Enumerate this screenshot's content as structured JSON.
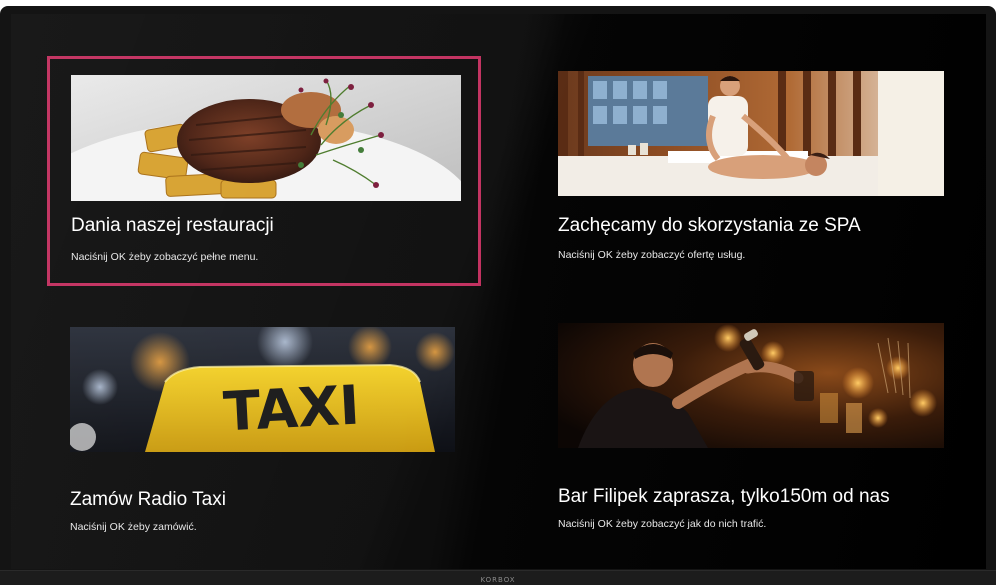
{
  "brand": "KORBOX",
  "tiles": [
    {
      "title": "Dania naszej restauracji",
      "subtitle": "Naciśnij OK żeby zobaczyć pełne menu.",
      "image": "steak-dish-photo"
    },
    {
      "title": "Zachęcamy do skorzystania ze SPA",
      "subtitle": "Naciśnij OK żeby zobaczyć ofertę usług.",
      "image": "spa-massage-photo"
    },
    {
      "title": "Zamów Radio Taxi",
      "subtitle": "Naciśnij OK żeby zamówić.",
      "image": "taxi-sign-photo",
      "sign_text": "TAXI"
    },
    {
      "title": "Bar Filipek zaprasza, tylko150m od nas",
      "subtitle": "Naciśnij OK żeby zobaczyć jak do nich trafić.",
      "image": "bartender-photo"
    }
  ],
  "colors": {
    "selection": "#c2305f",
    "background": "#000000",
    "text": "#ffffff"
  }
}
